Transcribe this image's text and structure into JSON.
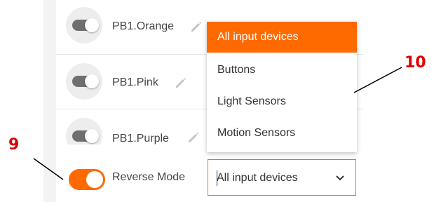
{
  "rows": [
    {
      "label": "PB1.Orange"
    },
    {
      "label": "PB1.Pink"
    },
    {
      "label": "PB1.Purple"
    }
  ],
  "reverse_mode": {
    "label": "Reverse Mode",
    "enabled": true
  },
  "device_select": {
    "value": "All input devices"
  },
  "dropdown": {
    "items": [
      "All input devices",
      "Buttons",
      "Light Sensors",
      "Motion Sensors"
    ],
    "selected": 0
  },
  "callouts": {
    "left": "9",
    "right": "10"
  },
  "colors": {
    "accent": "#ff6a00",
    "callout": "#e00000"
  }
}
